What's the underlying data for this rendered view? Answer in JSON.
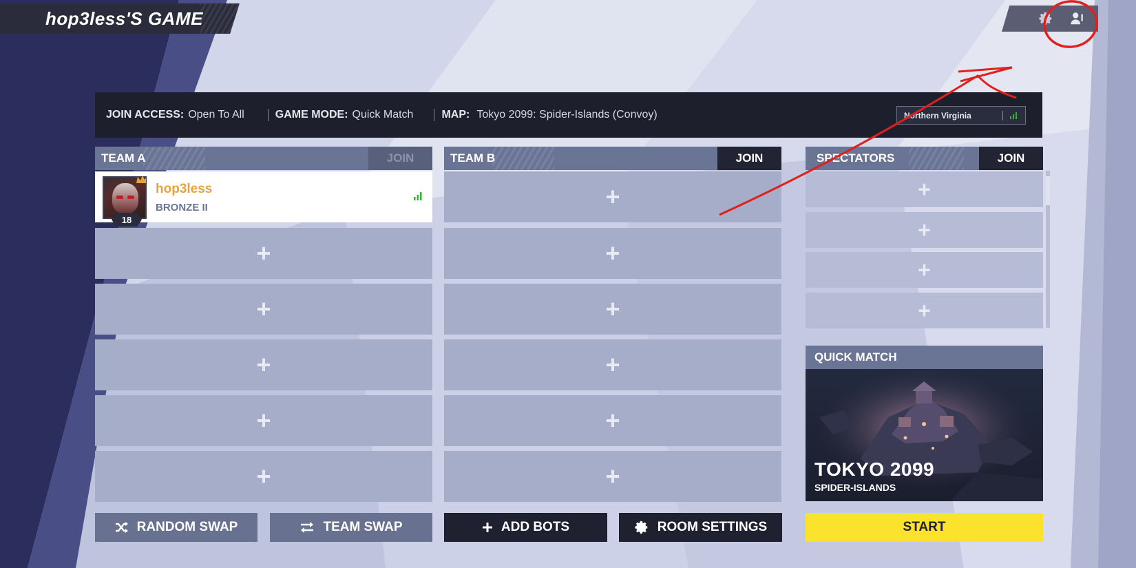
{
  "lobby": {
    "title": "hop3less'S GAME"
  },
  "info": {
    "join_access_label": "JOIN ACCESS:",
    "join_access_value": "Open To All",
    "game_mode_label": "GAME MODE:",
    "game_mode_value": "Quick Match",
    "map_label": "MAP:",
    "map_value": "Tokyo 2099: Spider-Islands (Convoy)",
    "region": "Northern Virginia"
  },
  "teams": [
    {
      "name": "TEAM A",
      "join_label": "JOIN",
      "join_enabled": false
    },
    {
      "name": "TEAM B",
      "join_label": "JOIN",
      "join_enabled": true
    }
  ],
  "spectators": {
    "name": "SPECTATORS",
    "join_label": "JOIN"
  },
  "player": {
    "name": "hop3less",
    "rank": "BRONZE II",
    "level": "18",
    "host": true
  },
  "slot_icon": "+",
  "map_card": {
    "header": "QUICK MATCH",
    "name": "TOKYO 2099",
    "subtitle": "SPIDER-ISLANDS"
  },
  "buttons": {
    "random_swap": "RANDOM SWAP",
    "team_swap": "TEAM SWAP",
    "add_bots": "ADD BOTS",
    "room_settings": "ROOM SETTINGS",
    "start": "START"
  },
  "icons": {
    "top_bar": [
      "gear-icon",
      "friends-icon"
    ],
    "random_swap": "shuffle-icon",
    "team_swap": "swap-arrows-icon",
    "add_bots": "plus-icon",
    "room_settings": "gear-icon",
    "signal": "signal-bars-icon",
    "host": "crown-icon"
  },
  "colors": {
    "accent_start": "#fbe22c",
    "player_name": "#e6a43a",
    "signal": "#2fb52f",
    "annotation": "#e0201c",
    "panel_dark": "#1d1f2c",
    "header": "#6a7494",
    "slot": "#a6adc9"
  }
}
